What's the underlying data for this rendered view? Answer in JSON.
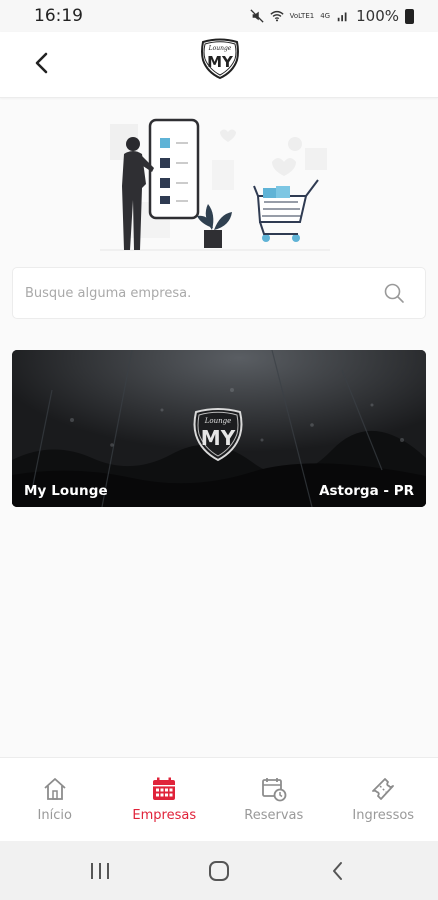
{
  "status_bar": {
    "time": "16:19",
    "battery": "100%",
    "network_labels": [
      "VoLTE1",
      "LTE",
      "4G"
    ]
  },
  "header": {
    "logo_text": "MY",
    "logo_subtext": "Lounge"
  },
  "search": {
    "placeholder": "Busque alguma empresa.",
    "value": ""
  },
  "companies": [
    {
      "name": "My Lounge",
      "location": "Astorga - PR",
      "logo_text": "MY",
      "logo_subtext": "Lounge"
    }
  ],
  "bottom_nav": {
    "items": [
      {
        "label": "Início",
        "icon": "home-icon",
        "active": false
      },
      {
        "label": "Empresas",
        "icon": "calendar-icon",
        "active": true
      },
      {
        "label": "Reservas",
        "icon": "reservations-icon",
        "active": false
      },
      {
        "label": "Ingressos",
        "icon": "ticket-icon",
        "active": false
      }
    ]
  },
  "colors": {
    "accent": "#e0233a",
    "inactive": "#999999",
    "card_bg": "#141516"
  }
}
